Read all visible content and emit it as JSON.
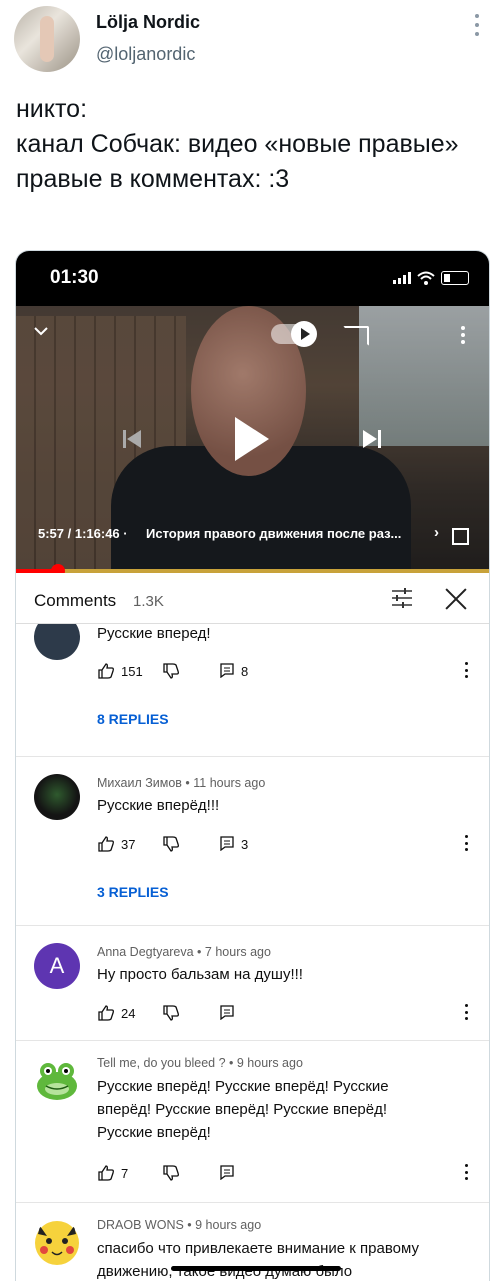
{
  "tweet": {
    "author_name": "Lölja Nordic",
    "author_handle": "@loljanordic",
    "text": "никто:\nканал Собчак: видео «новые правые»\nправые в комментах:  :3"
  },
  "phone": {
    "status_time": "01:30"
  },
  "video": {
    "time": "5:57 / 1:16:46 ·",
    "title": "История правого движения после раз...",
    "progress_fraction": 0.077
  },
  "comments_panel": {
    "title": "Comments",
    "count": "1.3K"
  },
  "comments": [
    {
      "author": "",
      "meta": "",
      "text": "Русские вперед!",
      "likes": "151",
      "replies": "8",
      "replies_link": "8 REPLIES"
    },
    {
      "author": "Михаил Зимов",
      "meta": "Михаил Зимов • 11 hours ago",
      "text": "Русские вперёд!!!",
      "likes": "37",
      "replies": "3",
      "replies_link": "3 REPLIES"
    },
    {
      "author": "Anna Degtyareva",
      "meta": "Anna Degtyareva • 7 hours ago",
      "avatar_letter": "A",
      "avatar_color": "#5e35b1",
      "text": "Ну просто бальзам на душу!!!",
      "likes": "24"
    },
    {
      "author": "Tell me, do you bleed ?",
      "meta": "Tell me, do you bleed ? • 9 hours ago",
      "avatar_icon": "frog-icon",
      "text": "Русские вперёд! Русские вперёд! Русские вперёд! Русские вперёд! Русские вперёд! Русские вперёд!",
      "likes": "7"
    },
    {
      "author": "DRAOB WONS",
      "meta": "DRAOB WONS • 9 hours ago",
      "avatar_icon": "pikachu-icon",
      "text": "спасибо что привлекаете внимание к правому движению, такое видео думаю было"
    }
  ],
  "colors": {
    "accent_red": "#ff0000",
    "link_blue": "#065fd4",
    "avatar_purple": "#5e35b1"
  }
}
